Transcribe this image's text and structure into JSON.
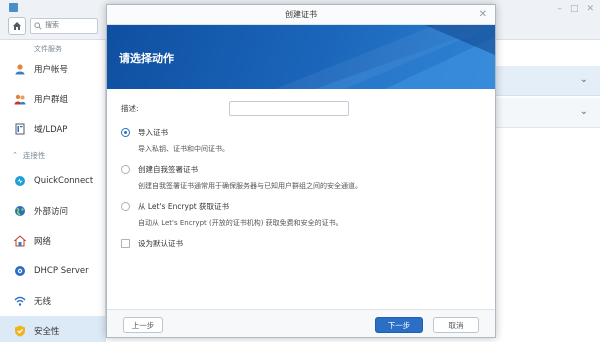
{
  "app": {
    "search_placeholder": "搜索"
  },
  "sidebar": {
    "partial_item": "文件服务",
    "items": [
      {
        "label": "用户帐号",
        "icon": "user-icon"
      },
      {
        "label": "用户群组",
        "icon": "group-icon"
      },
      {
        "label": "域/LDAP",
        "icon": "domain-icon"
      }
    ],
    "section": "连接性",
    "section_items": [
      {
        "label": "QuickConnect",
        "icon": "quickconnect-icon"
      },
      {
        "label": "外部访问",
        "icon": "globe-icon"
      },
      {
        "label": "网络",
        "icon": "network-icon"
      },
      {
        "label": "DHCP Server",
        "icon": "dhcp-icon"
      },
      {
        "label": "无线",
        "icon": "wifi-icon"
      },
      {
        "label": "安全性",
        "icon": "shield-icon",
        "active": true
      }
    ]
  },
  "modal": {
    "title": "创建证书",
    "banner_title": "请选择动作",
    "description_label": "描述:",
    "description_value": "",
    "options": [
      {
        "label": "导入证书",
        "desc": "导入私钥、证书和中间证书。",
        "selected": true
      },
      {
        "label": "创建自我签署证书",
        "desc": "创建自我签署证书通常用于确保服务器与已知用户群组之间的安全通道。",
        "selected": false
      },
      {
        "label": "从 Let's Encrypt 获取证书",
        "desc": "自动从 Let's Encrypt (开放的证书机构) 获取免费和安全的证书。",
        "selected": false
      }
    ],
    "default_checkbox_label": "设为默认证书",
    "default_checked": false,
    "buttons": {
      "prev": "上一步",
      "next": "下一步",
      "cancel": "取消"
    }
  },
  "colors": {
    "accent": "#2a6fc4",
    "banner": "#1b66bb",
    "active_bg": "#dce9f6"
  }
}
